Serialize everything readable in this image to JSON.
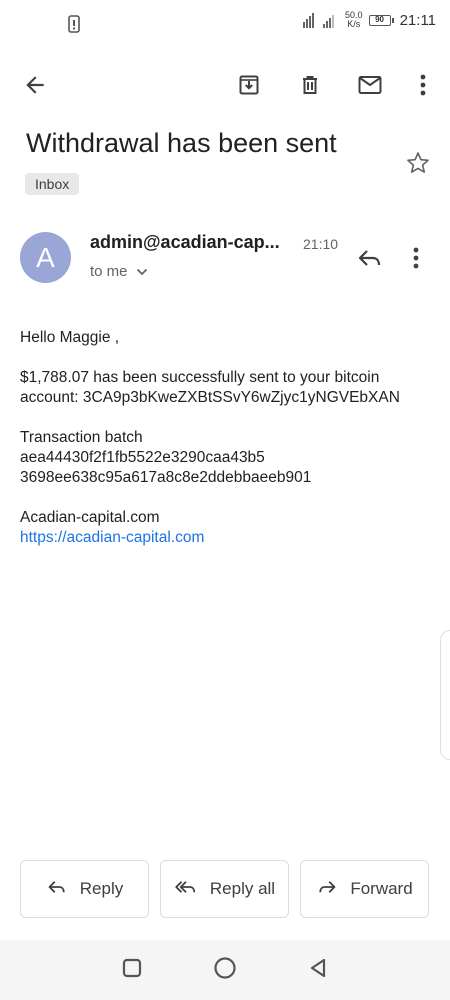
{
  "statusbar": {
    "net_speed_value": "50.0",
    "net_speed_unit": "K/s",
    "battery": "90",
    "time": "21:11"
  },
  "appbar": {
    "icons": [
      "back-arrow-icon",
      "archive-icon",
      "delete-icon",
      "mark-unread-icon",
      "more-vert-icon"
    ]
  },
  "email": {
    "subject": "Withdrawal has been sent",
    "label": "Inbox",
    "sender_initial": "A",
    "sender": "admin@acadian-cap...",
    "time": "21:10",
    "recipient": "to me",
    "avatar_color": "#99a6d6"
  },
  "body": {
    "greeting": "Hello Maggie ,",
    "line1": "$1,788.07 has been successfully sent to your bitcoin",
    "line2": "account: 3CA9p3bKweZXBtSSvY6wZjyc1yNGVEbXAN",
    "batch_label": "Transaction batch",
    "batch_line1": "aea44430f2f1fb5522e3290caa43b5",
    "batch_line2": "3698ee638c95a617a8c8e2ddebbaeeb901",
    "company": "Acadian-capital.com",
    "link": "https://acadian-capital.com"
  },
  "actions": {
    "reply": "Reply",
    "reply_all": "Reply all",
    "forward": "Forward"
  },
  "colors": {
    "link": "#1a73e8",
    "text": "#202124",
    "secondary": "#5f6368"
  }
}
